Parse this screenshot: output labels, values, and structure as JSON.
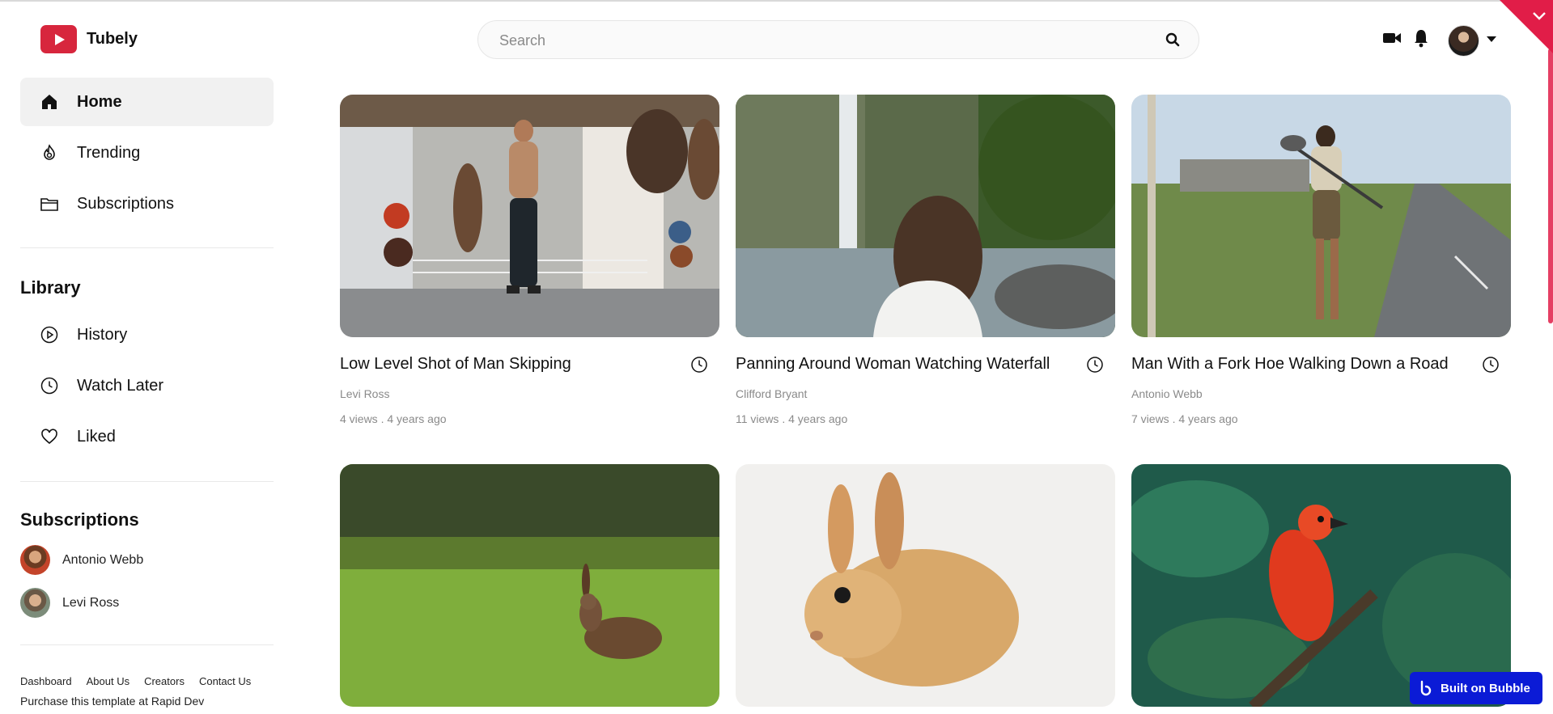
{
  "app": {
    "name": "Tubely"
  },
  "search": {
    "placeholder": "Search",
    "value": ""
  },
  "nav": {
    "items": [
      {
        "label": "Home",
        "icon": "home-icon",
        "active": true
      },
      {
        "label": "Trending",
        "icon": "flame-icon"
      },
      {
        "label": "Subscriptions",
        "icon": "folder-icon"
      }
    ]
  },
  "library": {
    "title": "Library",
    "items": [
      {
        "label": "History",
        "icon": "play-circle-icon"
      },
      {
        "label": "Watch Later",
        "icon": "clock-icon"
      },
      {
        "label": "Liked",
        "icon": "heart-icon"
      }
    ]
  },
  "subscriptions": {
    "title": "Subscriptions",
    "channels": [
      {
        "name": "Antonio Webb"
      },
      {
        "name": "Levi Ross"
      }
    ]
  },
  "footer": {
    "links": [
      "Dashboard",
      "About Us",
      "Creators",
      "Contact Us"
    ],
    "note": "Purchase this template at Rapid Dev"
  },
  "videos": [
    {
      "title": "Low Level Shot of Man Skipping",
      "author": "Levi Ross",
      "stats": "4 views . 4 years ago",
      "thumb": "gym"
    },
    {
      "title": "Panning Around Woman Watching Waterfall",
      "author": "Clifford Bryant",
      "stats": "11 views . 4 years ago",
      "thumb": "waterfall"
    },
    {
      "title": "Man With a Fork Hoe Walking Down a Road",
      "author": "Antonio Webb",
      "stats": "7 views . 4 years ago",
      "thumb": "road"
    },
    {
      "title": "",
      "author": "",
      "stats": "",
      "thumb": "hare"
    },
    {
      "title": "",
      "author": "",
      "stats": "",
      "thumb": "rabbit"
    },
    {
      "title": "",
      "author": "",
      "stats": "",
      "thumb": "bird"
    }
  ],
  "badge": {
    "label": "Built on Bubble"
  },
  "colors": {
    "brand": "#d7263d",
    "accent": "#e11d48",
    "bubble": "#0b1bd6"
  }
}
